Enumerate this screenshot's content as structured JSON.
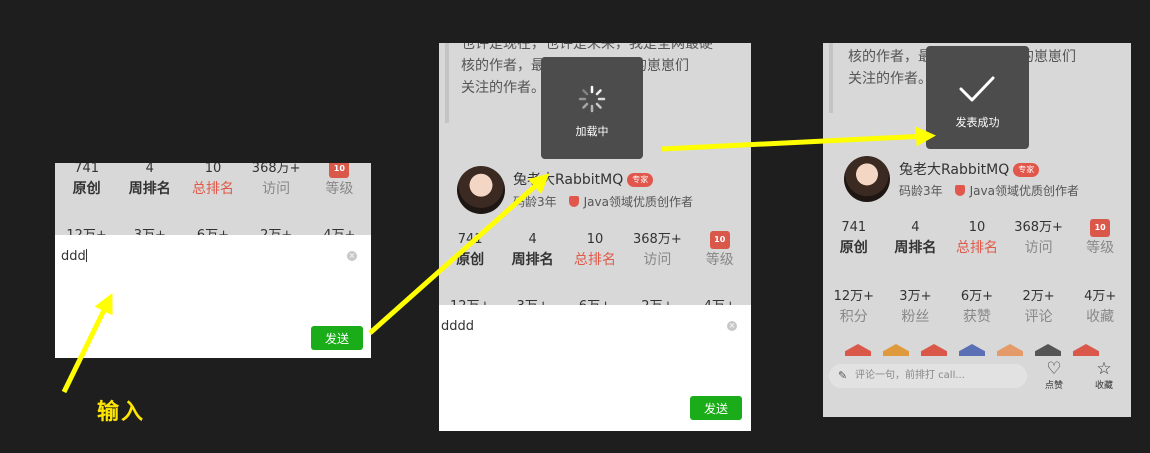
{
  "colors": {
    "arrow": "#ffff00",
    "send": "#1aad19",
    "accent_red": "#e05a4a"
  },
  "step1": {
    "stats_row1": [
      {
        "num": "741",
        "label": "原创",
        "style": "bold"
      },
      {
        "num": "4",
        "label": "周排名",
        "style": "bold"
      },
      {
        "num": "10",
        "label": "总排名",
        "style": "red"
      },
      {
        "num": "368万+",
        "label": "访问",
        "style": "muted"
      },
      {
        "num": "",
        "label": "等级",
        "style": "muted",
        "icon": "level-10-icon"
      }
    ],
    "stats_row2_partial": [
      "12万+",
      "3万+",
      "6万+",
      "2万+",
      "4万+"
    ],
    "input_value": "ddd",
    "send_label": "发送"
  },
  "step2": {
    "intro_lines": [
      "也许是现在，也许是未来，我是全网最硬",
      "核的作者，最",
      "关注的作者。"
    ],
    "intro_tail": "程的崽崽们",
    "toast_label": "加载中",
    "username": "兔老大RabbitMQ",
    "expert_badge": "专家",
    "age": "码龄3年",
    "honor": "Java领域优质创作者",
    "stats_row1": [
      {
        "num": "741",
        "label": "原创",
        "style": "bold"
      },
      {
        "num": "4",
        "label": "周排名",
        "style": "bold"
      },
      {
        "num": "10",
        "label": "总排名",
        "style": "red"
      },
      {
        "num": "368万+",
        "label": "访问",
        "style": "muted"
      },
      {
        "num": "",
        "label": "等级",
        "style": "muted",
        "icon": "level-10-icon"
      }
    ],
    "stats_row2_partial": [
      "12万+",
      "3万+",
      "6万+",
      "2万+",
      "4万+"
    ],
    "input_value": "dddd",
    "send_label": "发送"
  },
  "step3": {
    "intro_lines": [
      "核的作者，最",
      "关注的作者。"
    ],
    "intro_tail": "程的崽崽们",
    "toast_label": "发表成功",
    "username": "兔老大RabbitMQ",
    "expert_badge": "专家",
    "age": "码龄3年",
    "honor": "Java领域优质创作者",
    "stats_row1": [
      {
        "num": "741",
        "label": "原创",
        "style": "bold"
      },
      {
        "num": "4",
        "label": "周排名",
        "style": "bold"
      },
      {
        "num": "10",
        "label": "总排名",
        "style": "red"
      },
      {
        "num": "368万+",
        "label": "访问",
        "style": "muted"
      },
      {
        "num": "",
        "label": "等级",
        "style": "muted",
        "icon": "level-10-icon"
      }
    ],
    "stats_row2": [
      {
        "num": "12万+",
        "label": "积分"
      },
      {
        "num": "3万+",
        "label": "粉丝"
      },
      {
        "num": "6万+",
        "label": "获赞"
      },
      {
        "num": "2万+",
        "label": "评论"
      },
      {
        "num": "4万+",
        "label": "收藏"
      }
    ],
    "comment_placeholder": "评论一句，前排打 call...",
    "like_label": "点赞",
    "fav_label": "收藏"
  },
  "annotation": {
    "input_label": "输入"
  }
}
